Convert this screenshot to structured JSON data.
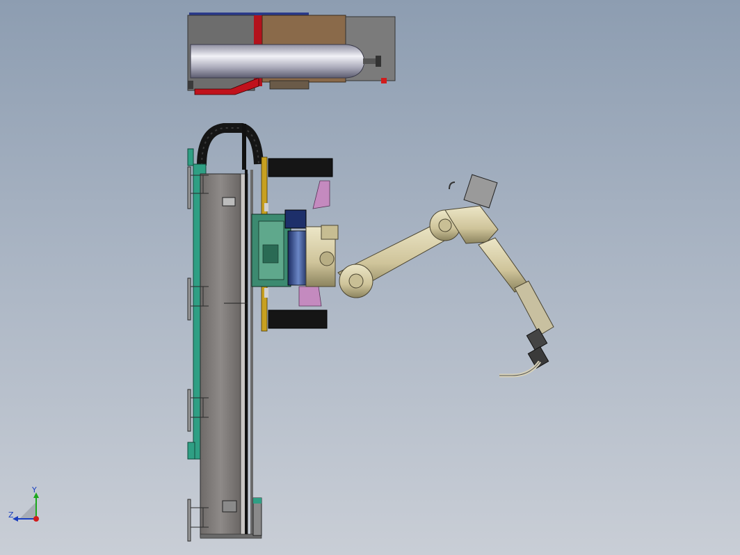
{
  "view": {
    "triad": {
      "y_label": "Y",
      "z_label": "Z",
      "colors": {
        "y": "#1ca81c",
        "z": "#1a3fbf",
        "x": "#d11c1c"
      }
    }
  },
  "model": {
    "components": [
      "wire-feeder-cabinet",
      "gas-cylinder",
      "linear-track-rail",
      "cable-carrier-chain",
      "track-carriage",
      "robot-base",
      "robot-lower-arm",
      "robot-upper-arm",
      "robot-wrist",
      "welding-torch"
    ],
    "colors": {
      "rail": "#8a8a8a",
      "rail_side": "#2f9f84",
      "arm": "#d8cfa6",
      "carriage": "#3c8a70",
      "cabinet_brown": "#8a6a4a",
      "cabinet_grey": "#7a7a7a",
      "cylinder": "#c9c9d2"
    }
  }
}
